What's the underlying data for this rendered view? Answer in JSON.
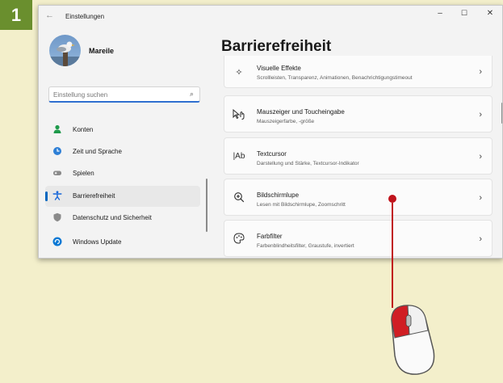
{
  "step_number": "1",
  "window": {
    "title": "Einstellungen",
    "back_icon": "back-arrow-icon",
    "controls": {
      "minimize": "–",
      "maximize": "☐",
      "close": "✕"
    }
  },
  "user": {
    "name": "Mareile"
  },
  "search": {
    "placeholder": "Einstellung suchen",
    "icon": "search-icon"
  },
  "sidebar": {
    "items": [
      {
        "label": "Konten",
        "icon": "person-icon",
        "color": "#1f9a4b",
        "active": false
      },
      {
        "label": "Zeit und Sprache",
        "icon": "globe-clock-icon",
        "color": "#2e7fd6",
        "active": false
      },
      {
        "label": "Spielen",
        "icon": "gamepad-icon",
        "color": "#8a8a8a",
        "active": false
      },
      {
        "label": "Barrierefreiheit",
        "icon": "accessibility-icon",
        "color": "#1666d9",
        "active": true
      },
      {
        "label": "Datenschutz und Sicherheit",
        "icon": "shield-icon",
        "color": "#8a8a8a",
        "active": false
      },
      {
        "label": "Windows Update",
        "icon": "windows-update-icon",
        "color": "#0a78d4",
        "active": false
      }
    ]
  },
  "main": {
    "title": "Barrierefreiheit",
    "cards": [
      {
        "title": "Visuelle Effekte",
        "description": "Scrollleisten, Transparenz, Animationen, Benachrichtigungstimeout",
        "icon": "sparkle-icon"
      },
      {
        "title": "Mauszeiger und Toucheingabe",
        "description": "Mauszeigerfarbe, -größe",
        "icon": "pointer-touch-icon"
      },
      {
        "title": "Textcursor",
        "description": "Darstellung und Stärke, Textcursor-Indikator",
        "icon": "text-cursor-icon"
      },
      {
        "title": "Bildschirmlupe",
        "description": "Lesen mit Bildschirmlupe, Zoomschritt",
        "icon": "magnifier-plus-icon"
      },
      {
        "title": "Farbfilter",
        "description": "Farbenblindheitsfilter, Graustufe, invertiert",
        "icon": "color-palette-icon"
      }
    ]
  },
  "colors": {
    "accent": "#0067c0",
    "callout": "#c0141c",
    "badge": "#6a8f2e",
    "backdrop": "#f3efcb"
  }
}
